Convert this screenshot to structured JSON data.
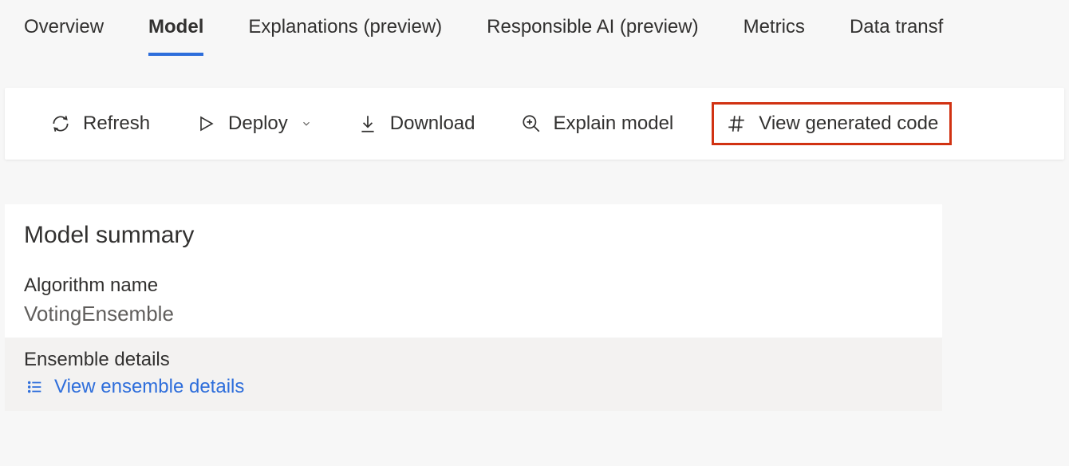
{
  "tabs": [
    {
      "label": "Overview",
      "active": false
    },
    {
      "label": "Model",
      "active": true
    },
    {
      "label": "Explanations (preview)",
      "active": false
    },
    {
      "label": "Responsible AI (preview)",
      "active": false
    },
    {
      "label": "Metrics",
      "active": false
    },
    {
      "label": "Data transf",
      "active": false
    }
  ],
  "toolbar": {
    "refresh": "Refresh",
    "deploy": "Deploy",
    "download": "Download",
    "explain": "Explain model",
    "view_code": "View generated code"
  },
  "summary": {
    "title": "Model summary",
    "algorithm_label": "Algorithm name",
    "algorithm_value": "VotingEnsemble",
    "ensemble_label": "Ensemble details",
    "ensemble_link": "View ensemble details"
  }
}
